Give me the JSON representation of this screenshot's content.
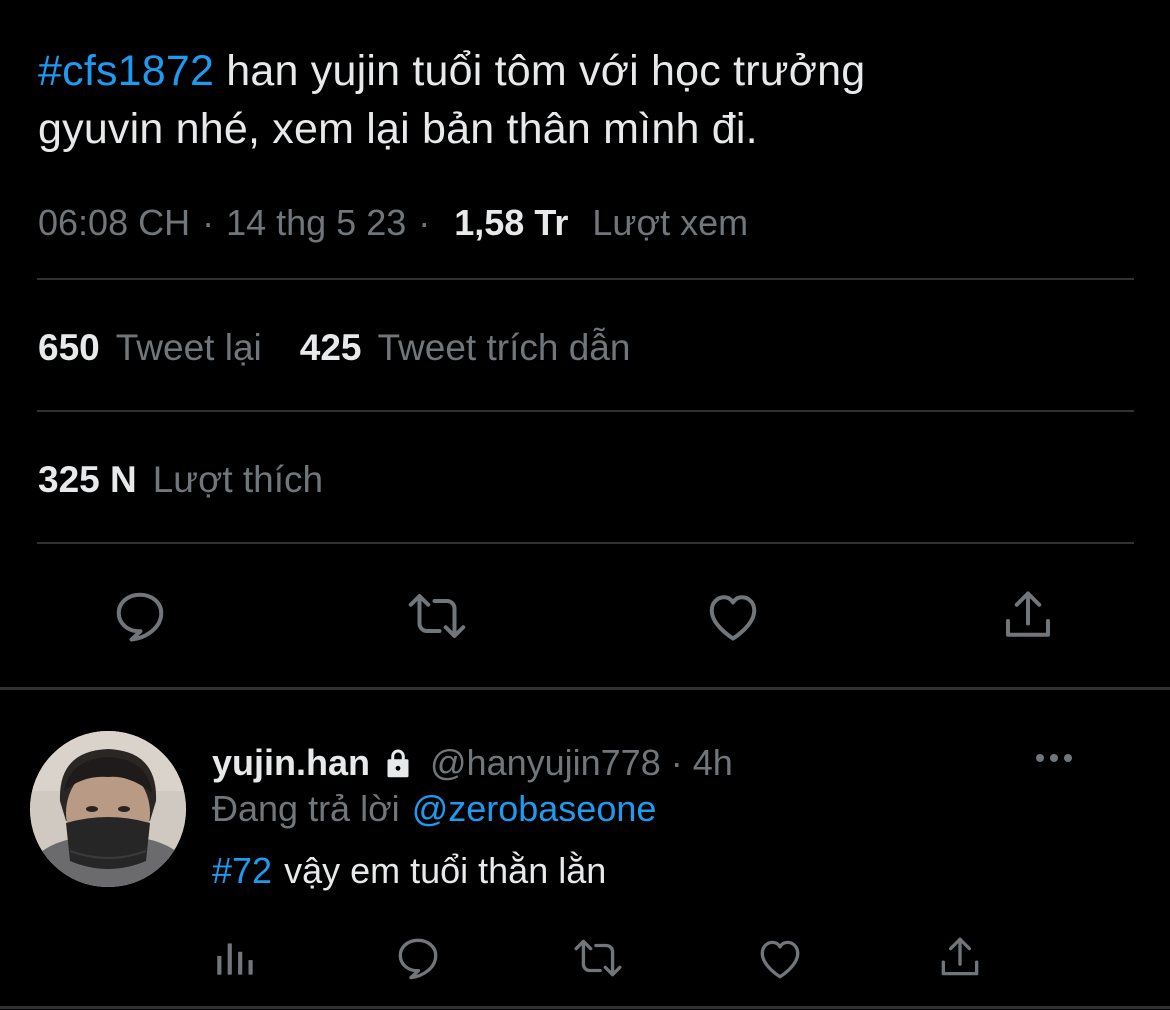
{
  "tweet": {
    "hashtag": "#cfs1872",
    "text_line1": " han yujin tuổi tôm với học trưởng",
    "text_line2": "gyuvin nhé, xem lại bản thân mình đi.",
    "time": "06:08 CH",
    "date": "14 thg 5 23",
    "separator": "·",
    "views_count": "1,58 Tr",
    "views_label": "Lượt xem"
  },
  "stats": {
    "retweets_count": "650",
    "retweets_label": "Tweet lại",
    "quotes_count": "425",
    "quotes_label": "Tweet trích dẫn",
    "likes_count": "325 N",
    "likes_label": "Lượt thích"
  },
  "actions": [
    "reply-icon",
    "retweet-icon",
    "like-icon",
    "share-icon"
  ],
  "reply": {
    "name": "yujin.han",
    "handle": "@hanyujin778",
    "separator": "·",
    "time": "4h",
    "replying_label": "Đang trả lời",
    "replying_to": "@zerobaseone",
    "hashtag": "#72",
    "text": "vậy em tuổi thằn lằn",
    "actions": [
      "analytics-icon",
      "reply-icon",
      "retweet-icon",
      "like-icon",
      "share-icon"
    ]
  },
  "colors": {
    "background": "#000000",
    "text": "#e7e9ea",
    "muted": "#71767b",
    "accent": "#1d9bf0",
    "divider": "#2f3336"
  }
}
